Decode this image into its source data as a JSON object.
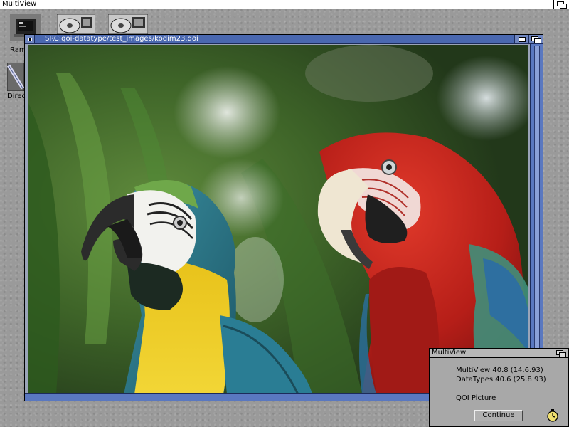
{
  "screen": {
    "title": "MultiView"
  },
  "desktop": {
    "icons": [
      {
        "label": "Ram"
      },
      {
        "label": "Direc"
      }
    ]
  },
  "window": {
    "title": "SRC:qoi-datatype/test_images/kodim23.qoi",
    "image_name": "parrots-photo"
  },
  "requester": {
    "title": "MultiView",
    "lines": [
      "MultiView 40.8 (14.6.93)",
      "DataTypes 40.6 (25.8.93)",
      "",
      "QOI Picture"
    ],
    "button_label": "Continue"
  },
  "colors": {
    "window_title_bg": "#4a68b0",
    "desktop_bg": "#9a9a9a",
    "requester_bg": "#a8a8a8"
  }
}
